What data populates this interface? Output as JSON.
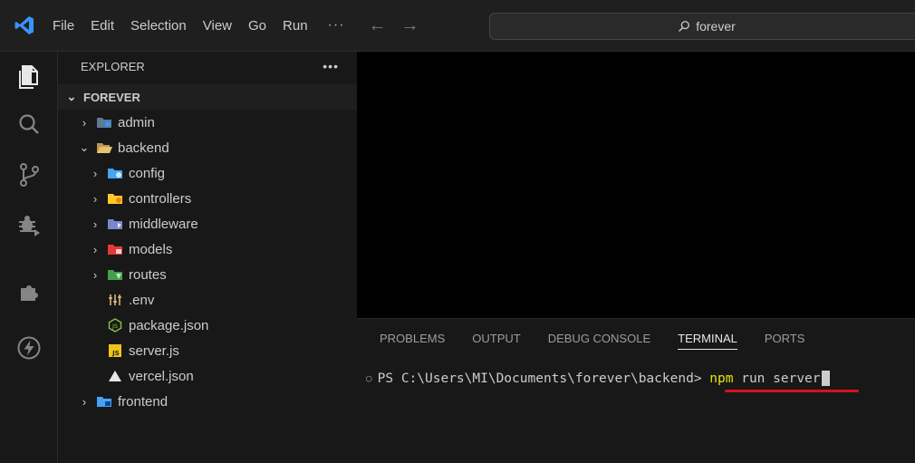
{
  "titlebar": {
    "menu": [
      "File",
      "Edit",
      "Selection",
      "View",
      "Go",
      "Run"
    ],
    "more": "···",
    "back_arrow": "←",
    "forward_arrow": "→",
    "search_text": "forever"
  },
  "activity": [
    "files-icon",
    "search-icon",
    "source-control-icon",
    "run-debug-icon",
    "extensions-icon",
    "lightning-icon"
  ],
  "sidebar": {
    "title": "EXPLORER",
    "dots": "•••",
    "root": "FOREVER",
    "items": [
      {
        "label": "admin",
        "chevron": "›",
        "icon": "folder-admin-icon"
      },
      {
        "label": "backend",
        "chevron": "⌄",
        "icon": "folder-open-icon"
      },
      {
        "label": "config",
        "chevron": "›",
        "icon": "folder-config-icon"
      },
      {
        "label": "controllers",
        "chevron": "›",
        "icon": "folder-controllers-icon"
      },
      {
        "label": "middleware",
        "chevron": "›",
        "icon": "folder-middleware-icon"
      },
      {
        "label": "models",
        "chevron": "›",
        "icon": "folder-models-icon"
      },
      {
        "label": "routes",
        "chevron": "›",
        "icon": "folder-routes-icon"
      },
      {
        "label": ".env",
        "chevron": "",
        "icon": "env-file-icon"
      },
      {
        "label": "package.json",
        "chevron": "",
        "icon": "nodejs-icon"
      },
      {
        "label": "server.js",
        "chevron": "",
        "icon": "js-file-icon"
      },
      {
        "label": "vercel.json",
        "chevron": "",
        "icon": "vercel-icon"
      },
      {
        "label": "frontend",
        "chevron": "›",
        "icon": "folder-frontend-icon"
      }
    ]
  },
  "panel": {
    "tabs": [
      "PROBLEMS",
      "OUTPUT",
      "DEBUG CONSOLE",
      "TERMINAL",
      "PORTS"
    ],
    "active_tab": "TERMINAL",
    "terminal": {
      "prompt": "PS C:\\Users\\MI\\Documents\\forever\\backend> ",
      "command": "npm",
      "args": " run server"
    }
  },
  "colors": {
    "accent_blue": "#3794ff",
    "command_yellow": "#e5e510",
    "underline_red": "#d0141e"
  }
}
